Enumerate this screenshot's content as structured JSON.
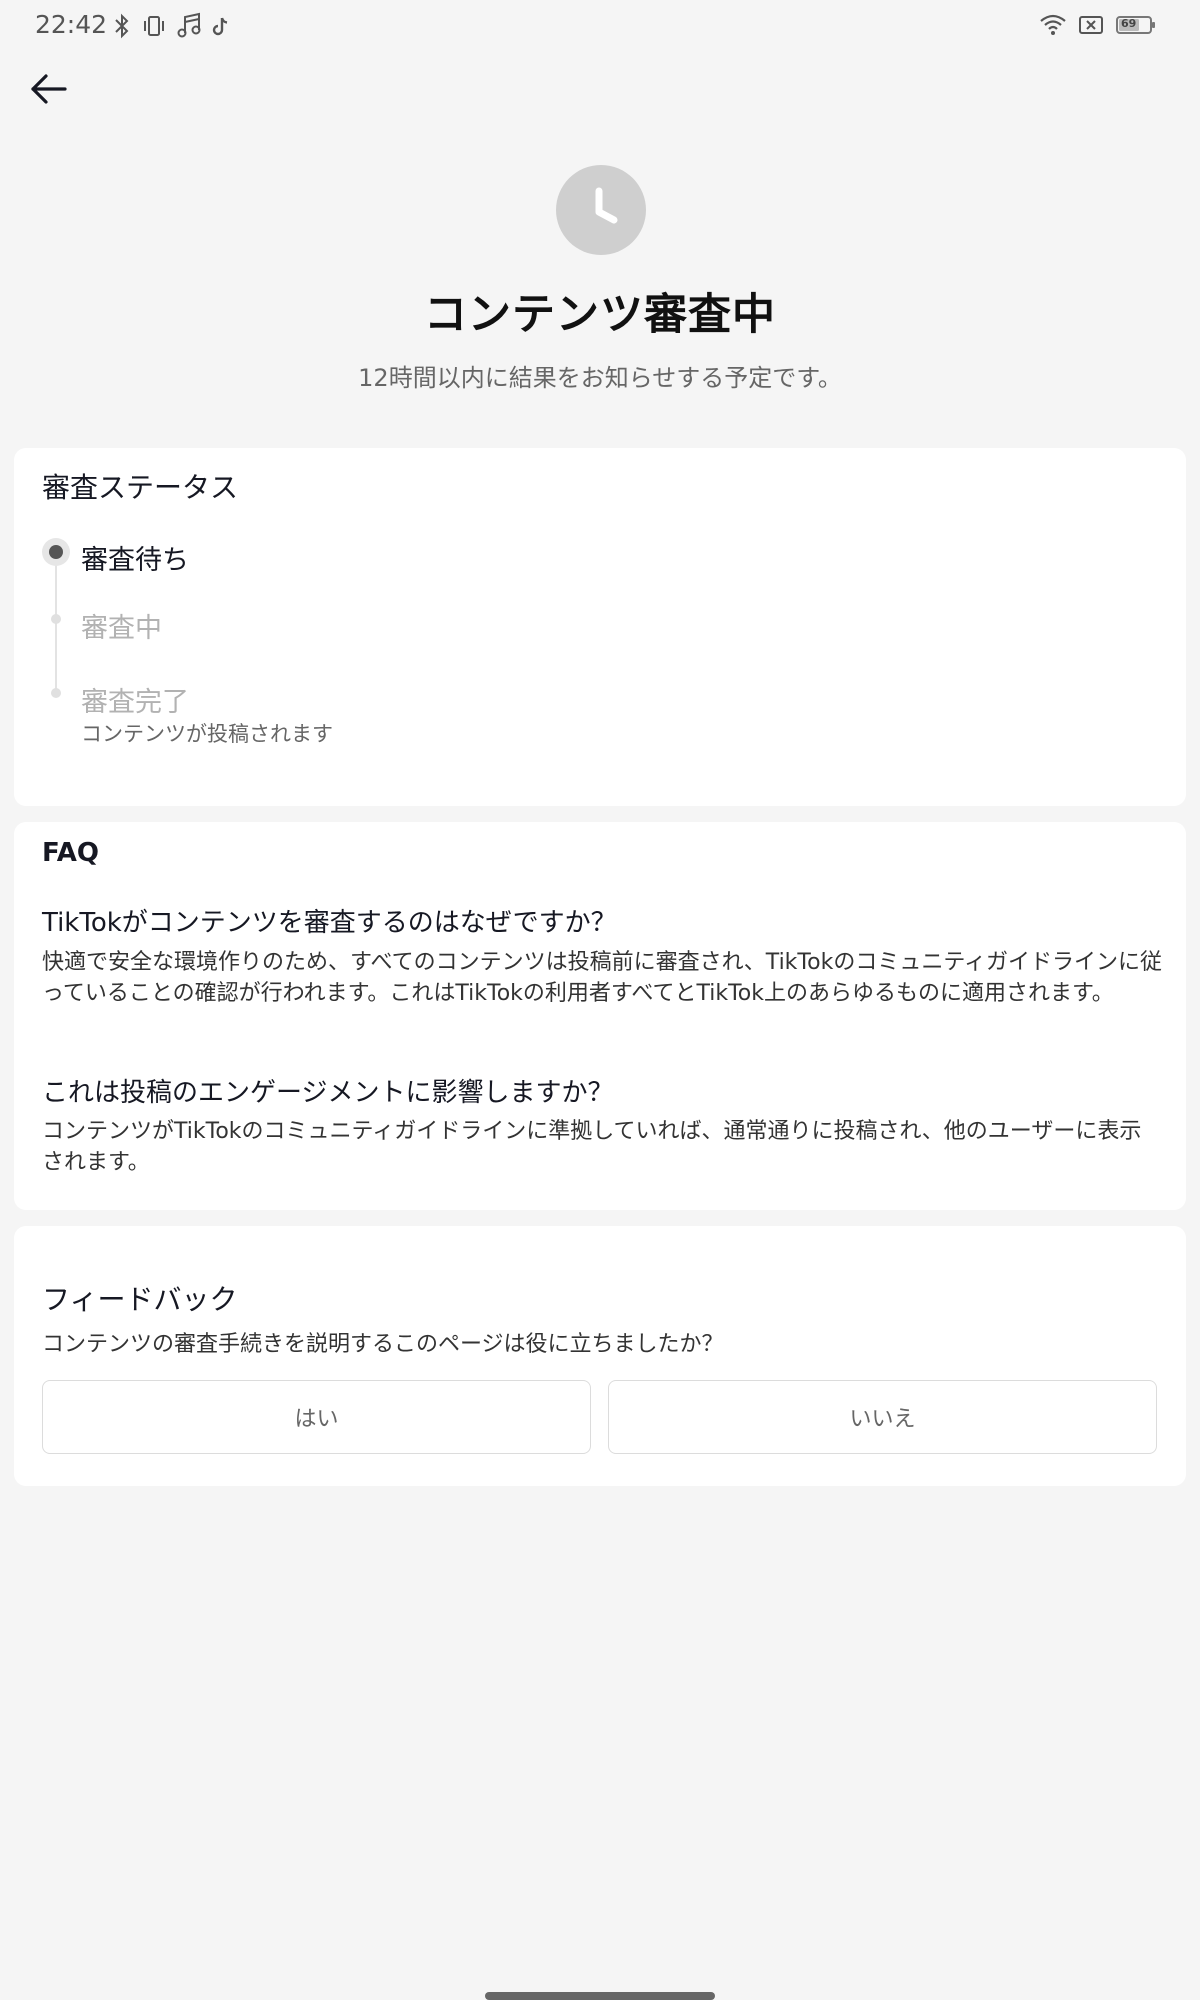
{
  "status_bar": {
    "time": "22:42",
    "left_icons": [
      "bluetooth-icon",
      "vibrate-icon",
      "music-icon",
      "tiktok-icon"
    ],
    "right_icons": [
      "wifi-icon",
      "no-sim-icon",
      "battery-icon"
    ],
    "battery": "69"
  },
  "header": {
    "icon": "clock-icon",
    "title": "コンテンツ審査中",
    "subtitle": "12時間以内に結果をお知らせする予定です。"
  },
  "review_status": {
    "title": "審査ステータス",
    "steps": [
      {
        "label": "審査待ち",
        "state": "active"
      },
      {
        "label": "審査中",
        "state": "inactive"
      },
      {
        "label": "審査完了",
        "state": "inactive",
        "description": "コンテンツが投稿されます"
      }
    ]
  },
  "faq": {
    "title": "FAQ",
    "items": [
      {
        "question": "TikTokがコンテンツを審査するのはなぜですか？",
        "answer": "快適で安全な環境作りのため、すべてのコンテンツは投稿前に審査され、TikTokのコミュニティガイドラインに従っていることの確認が行われます。これはTikTokの利用者すべてとTikTok上のあらゆるものに適用されます。"
      },
      {
        "question": "これは投稿のエンゲージメントに影響しますか？",
        "answer": "コンテンツがTikTokのコミュニティガイドラインに準拠していれば、通常通りに投稿され、他のユーザーに表示されます。"
      }
    ]
  },
  "feedback": {
    "title": "フィードバック",
    "question": "コンテンツの審査手続きを説明するこのページは役に立ちましたか？",
    "yes_label": "はい",
    "no_label": "いいえ"
  },
  "colors": {
    "background": "#f5f5f5",
    "card": "#ffffff",
    "clock_circle": "#cfcfcf",
    "inactive_text": "#b2b2b2"
  }
}
